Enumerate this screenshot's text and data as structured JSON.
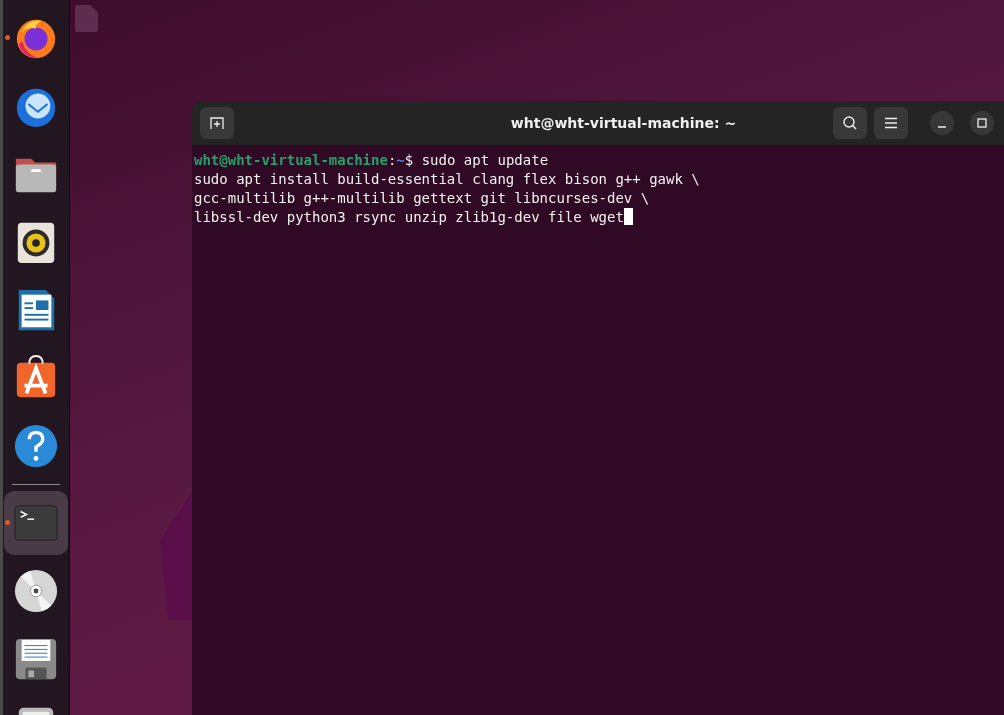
{
  "dock": {
    "items": [
      {
        "kind": "browser",
        "running": true,
        "selected": false
      },
      {
        "kind": "mail",
        "running": false,
        "selected": false
      },
      {
        "kind": "files",
        "running": false,
        "selected": false
      },
      {
        "kind": "music",
        "running": false,
        "selected": false
      },
      {
        "kind": "document",
        "running": false,
        "selected": false
      },
      {
        "kind": "store",
        "running": false,
        "selected": false
      },
      {
        "kind": "help",
        "running": false,
        "selected": false
      },
      {
        "kind": "separator"
      },
      {
        "kind": "terminal",
        "running": true,
        "selected": true
      },
      {
        "kind": "disc",
        "running": false,
        "selected": false
      },
      {
        "kind": "save",
        "running": false,
        "selected": false
      },
      {
        "kind": "drive"
      }
    ]
  },
  "terminal": {
    "title": "wht@wht-virtual-machine: ~",
    "prompt": {
      "user_host": "wht@wht-virtual-machine",
      "separator": ":",
      "path": "~",
      "symbol": "$"
    },
    "command": "sudo apt update",
    "lines": [
      "sudo apt install build-essential clang flex bison g++ gawk \\",
      "gcc-multilib g++-multilib gettext git libncurses-dev \\",
      "libssl-dev python3 rsync unzip zlib1g-dev file wget"
    ],
    "cursor": true
  }
}
